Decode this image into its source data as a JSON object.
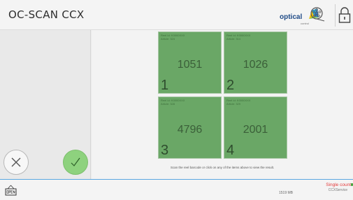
{
  "header": {
    "title": "OC-SCAN CCX",
    "logo_text": "optical",
    "logo_subtext": "control"
  },
  "grid": {
    "cells": [
      {
        "reel_line": "Reel Id: K0000XXX",
        "article_line": "Article: 324",
        "count": "1051",
        "index": "1"
      },
      {
        "reel_line": "Reel Id: K0000XXX",
        "article_line": "Article: 314",
        "count": "1026",
        "index": "2"
      },
      {
        "reel_line": "Reel Id: K0000XXX",
        "article_line": "Article: 328",
        "count": "4796",
        "index": "3"
      },
      {
        "reel_line": "Reel Id: K0000XXX",
        "article_line": "Article: 329",
        "count": "2001",
        "index": "4"
      }
    ],
    "hint": "Scan the reel barcode or click on any of the items above to view the result."
  },
  "footer": {
    "memory": "1519 MB",
    "mode": "Single count",
    "service": "CCXService"
  },
  "colors": {
    "cell_fill": "#6aa766",
    "confirm": "#8ed27e",
    "mode_text": "#e33b3b",
    "footer_rule": "#5aa7e0"
  }
}
